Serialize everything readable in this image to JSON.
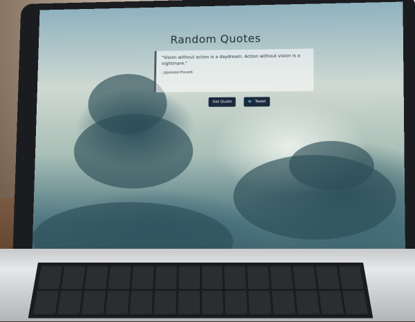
{
  "app": {
    "title": "Random Quotes",
    "quote": "\"Vision without action is a daydream. Action without vision is a nightmare.\"",
    "author": "- Japanese Proverb",
    "buttons": {
      "get_quote": "Get Quote",
      "tweet": "Tweet"
    }
  },
  "icons": {
    "tweet": "twitter-bird-icon"
  },
  "colors": {
    "button_bg": "#1a2a3c",
    "title": "#1f2f3b"
  }
}
